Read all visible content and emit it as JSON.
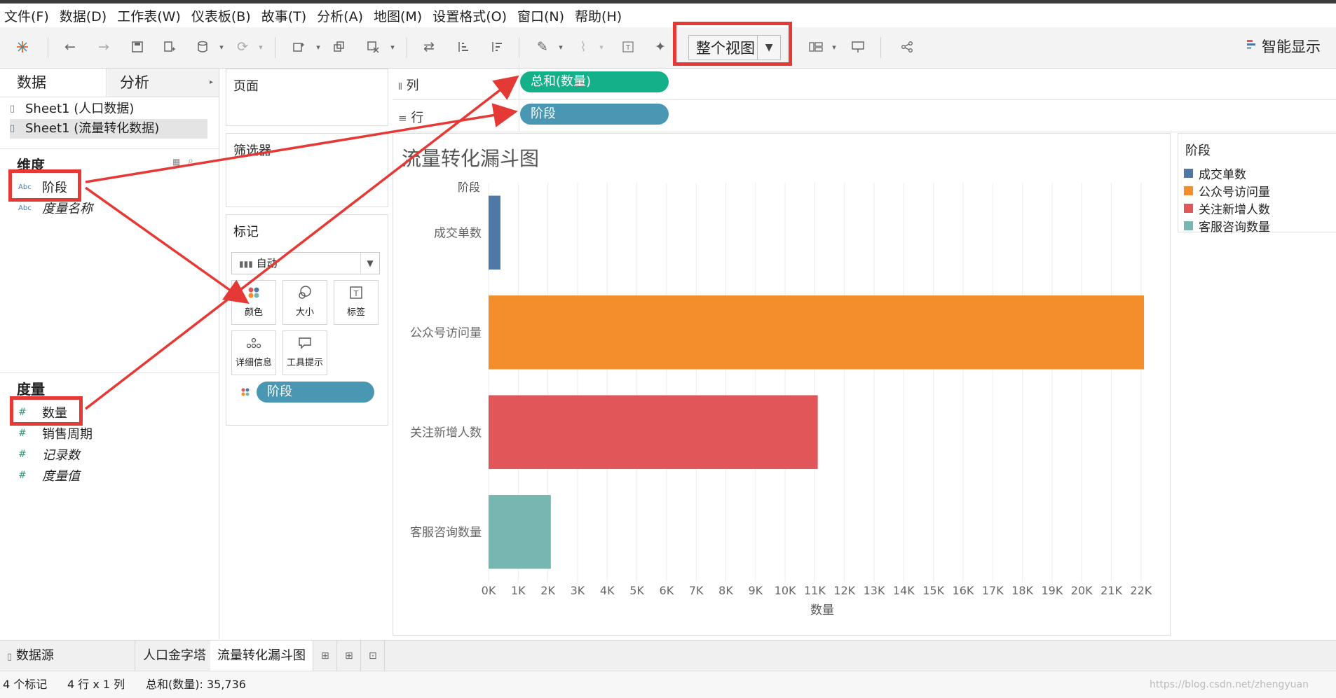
{
  "menu": [
    "文件(F)",
    "数据(D)",
    "工作表(W)",
    "仪表板(B)",
    "故事(T)",
    "分析(A)",
    "地图(M)",
    "设置格式(O)",
    "窗口(N)",
    "帮助(H)"
  ],
  "toolbar": {
    "view_mode": "整个视图",
    "smart_show": "智能显示"
  },
  "left_panel": {
    "tab_data": "数据",
    "tab_analysis": "分析",
    "sources": [
      "Sheet1 (人口数据)",
      "Sheet1 (流量转化数据)"
    ],
    "dimensions_title": "维度",
    "dimensions": [
      "阶段",
      "度量名称"
    ],
    "dim_icon_text": "Abc",
    "measures_title": "度量",
    "measures": [
      "数量",
      "销售周期",
      "记录数",
      "度量值"
    ]
  },
  "shelves": {
    "pages_title": "页面",
    "filters_title": "筛选器",
    "marks_title": "标记",
    "mark_type": "自动",
    "mark_buttons": [
      "颜色",
      "大小",
      "标签",
      "详细信息",
      "工具提示"
    ],
    "color_pill": "阶段",
    "columns_label": "列",
    "columns_pill": "总和(数量)",
    "rows_label": "行",
    "rows_pill": "阶段"
  },
  "chart_data": {
    "type": "bar",
    "orientation": "horizontal",
    "title": "流量转化漏斗图",
    "ylabel": "阶段",
    "xlabel": "数量",
    "categories": [
      "成交单数",
      "公众号访问量",
      "关注新增人数",
      "客服咨询数量"
    ],
    "values": [
      400,
      22100,
      11100,
      2100
    ],
    "colors": [
      "#4e79a7",
      "#f28e2b",
      "#e15759",
      "#76b7b2"
    ],
    "xlim": [
      0,
      22500
    ],
    "xticks": [
      0,
      1000,
      2000,
      3000,
      4000,
      5000,
      6000,
      7000,
      8000,
      9000,
      10000,
      11000,
      12000,
      13000,
      14000,
      15000,
      16000,
      17000,
      18000,
      19000,
      20000,
      21000,
      22000
    ],
    "xtick_labels": [
      "0K",
      "1K",
      "2K",
      "3K",
      "4K",
      "5K",
      "6K",
      "7K",
      "8K",
      "9K",
      "10K",
      "11K",
      "12K",
      "13K",
      "14K",
      "15K",
      "16K",
      "17K",
      "18K",
      "19K",
      "20K",
      "21K",
      "22K"
    ],
    "grid": true,
    "legend": {
      "title": "阶段",
      "position": "right",
      "items": [
        "成交单数",
        "公众号访问量",
        "关注新增人数",
        "客服咨询数量"
      ],
      "colors": [
        "#4e79a7",
        "#f28e2b",
        "#e15759",
        "#76b7b2"
      ]
    }
  },
  "bottom_tabs": [
    "数据源",
    "人口金字塔",
    "流量转化漏斗图"
  ],
  "status": {
    "marks": "4 个标记",
    "dims": "4 行 x 1 列",
    "sum": "总和(数量): 35,736"
  },
  "watermark": "https://blog.csdn.net/zhengyuan"
}
